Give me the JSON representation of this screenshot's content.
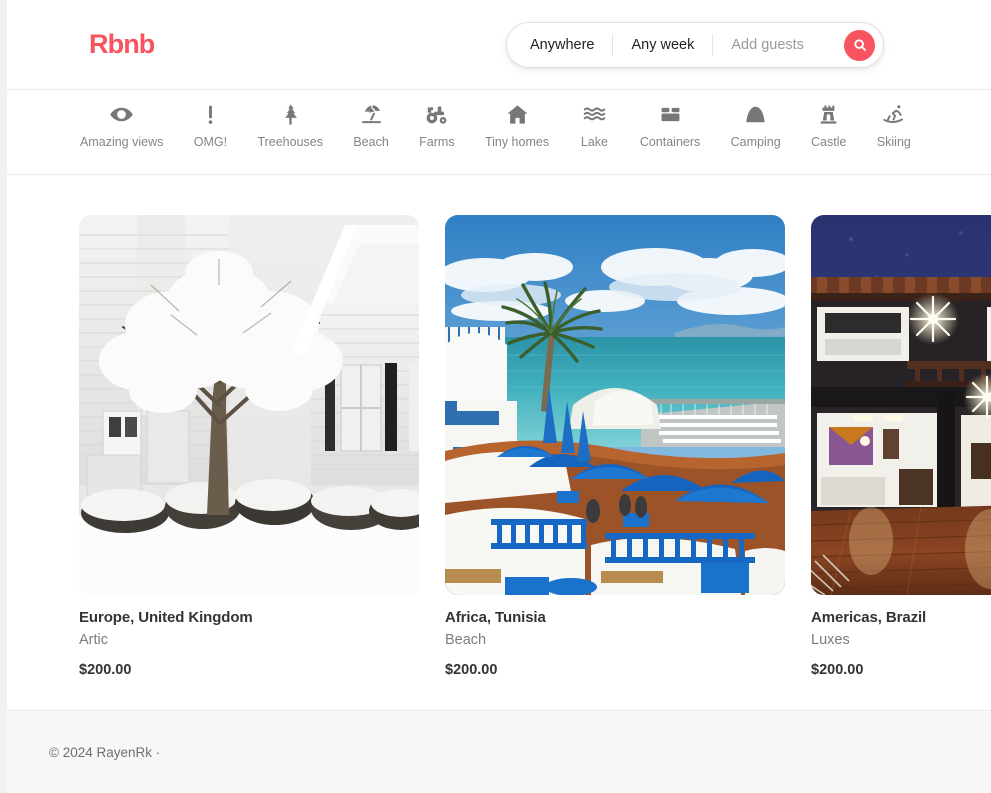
{
  "header": {
    "brand": "Rbnb",
    "brand_color": "#f8545f",
    "search": {
      "where_label": "Anywhere",
      "when_label": "Any week",
      "guests_placeholder": "Add guests",
      "search_icon": "search-icon",
      "search_button_color": "#f8545f"
    }
  },
  "categories": [
    {
      "label": "Amazing views",
      "icon": "eye-icon"
    },
    {
      "label": "OMG!",
      "icon": "exclamation-icon"
    },
    {
      "label": "Treehouses",
      "icon": "tree-icon"
    },
    {
      "label": "Beach",
      "icon": "beach-umbrella-icon"
    },
    {
      "label": "Farms",
      "icon": "tractor-icon"
    },
    {
      "label": "Tiny homes",
      "icon": "home-icon"
    },
    {
      "label": "Lake",
      "icon": "waves-icon"
    },
    {
      "label": "Containers",
      "icon": "container-icon"
    },
    {
      "label": "Camping",
      "icon": "tent-icon"
    },
    {
      "label": "Castle",
      "icon": "castle-icon"
    },
    {
      "label": "Skiing",
      "icon": "skier-icon"
    }
  ],
  "listings": [
    {
      "title": "Europe, United Kingdom",
      "subtitle": "Artic",
      "price": "$200.00",
      "image_alt": "snow-covered-tree-and-white-house"
    },
    {
      "title": "Africa, Tunisia",
      "subtitle": "Beach",
      "price": "$200.00",
      "image_alt": "blue-parasols-seaside-terrace"
    },
    {
      "title": "Americas, Brazil",
      "subtitle": "Luxes",
      "price": "$200.00",
      "image_alt": "modern-lit-house-wooden-deck-at-night"
    }
  ],
  "footer": {
    "copyright": "© 2024 RayenRk  ·"
  }
}
